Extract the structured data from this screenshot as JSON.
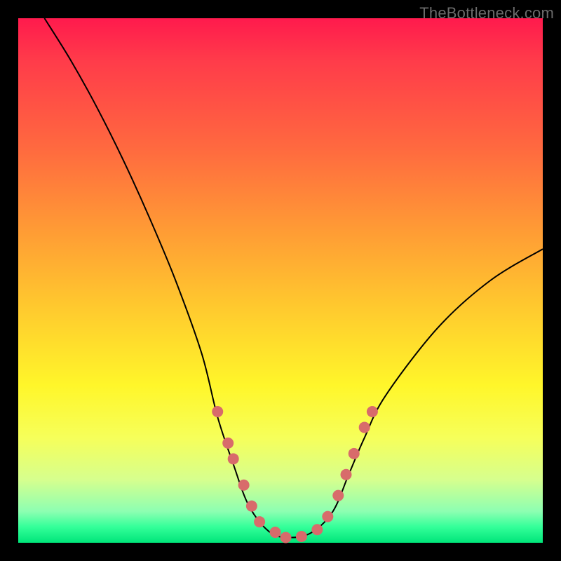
{
  "watermark": "TheBottleneck.com",
  "chart_data": {
    "type": "line",
    "title": "",
    "xlabel": "",
    "ylabel": "",
    "xlim": [
      0,
      100
    ],
    "ylim": [
      0,
      100
    ],
    "grid": false,
    "curve": {
      "name": "bottleneck-curve",
      "points": [
        {
          "x": 5,
          "y": 100
        },
        {
          "x": 10,
          "y": 92
        },
        {
          "x": 15,
          "y": 83
        },
        {
          "x": 20,
          "y": 73
        },
        {
          "x": 25,
          "y": 62
        },
        {
          "x": 30,
          "y": 50
        },
        {
          "x": 35,
          "y": 36
        },
        {
          "x": 38,
          "y": 24
        },
        {
          "x": 41,
          "y": 15
        },
        {
          "x": 44,
          "y": 7
        },
        {
          "x": 48,
          "y": 2
        },
        {
          "x": 52,
          "y": 1
        },
        {
          "x": 56,
          "y": 2
        },
        {
          "x": 60,
          "y": 6
        },
        {
          "x": 63,
          "y": 13
        },
        {
          "x": 66,
          "y": 20
        },
        {
          "x": 70,
          "y": 28
        },
        {
          "x": 80,
          "y": 41
        },
        {
          "x": 90,
          "y": 50
        },
        {
          "x": 100,
          "y": 56
        }
      ]
    },
    "markers": [
      {
        "x": 38,
        "y": 25
      },
      {
        "x": 40,
        "y": 19
      },
      {
        "x": 41,
        "y": 16
      },
      {
        "x": 43,
        "y": 11
      },
      {
        "x": 44.5,
        "y": 7
      },
      {
        "x": 46,
        "y": 4
      },
      {
        "x": 49,
        "y": 2
      },
      {
        "x": 51,
        "y": 1
      },
      {
        "x": 54,
        "y": 1.2
      },
      {
        "x": 57,
        "y": 2.5
      },
      {
        "x": 59,
        "y": 5
      },
      {
        "x": 61,
        "y": 9
      },
      {
        "x": 62.5,
        "y": 13
      },
      {
        "x": 64,
        "y": 17
      },
      {
        "x": 66,
        "y": 22
      },
      {
        "x": 67.5,
        "y": 25
      }
    ],
    "marker_color": "#d86b6b"
  }
}
